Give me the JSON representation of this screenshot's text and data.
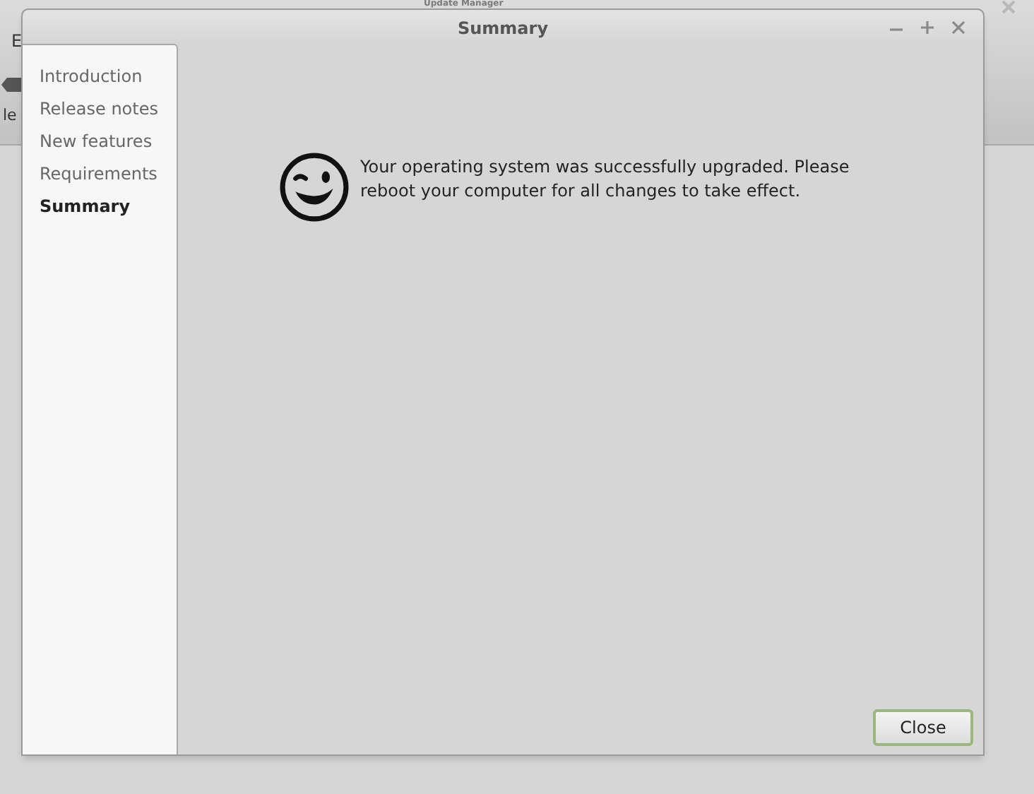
{
  "background_window": {
    "title": "Update Manager",
    "menu_label": "E",
    "toolbar_label": "le"
  },
  "dialog": {
    "title": "Summary",
    "sidebar": {
      "items": [
        {
          "label": "Introduction",
          "selected": false
        },
        {
          "label": "Release notes",
          "selected": false
        },
        {
          "label": "New features",
          "selected": false
        },
        {
          "label": "Requirements",
          "selected": false
        },
        {
          "label": "Summary",
          "selected": true
        }
      ]
    },
    "message": "Your operating system was successfully upgraded. Please reboot your computer for all changes to take effect.",
    "buttons": [
      {
        "label": "Close"
      }
    ]
  }
}
